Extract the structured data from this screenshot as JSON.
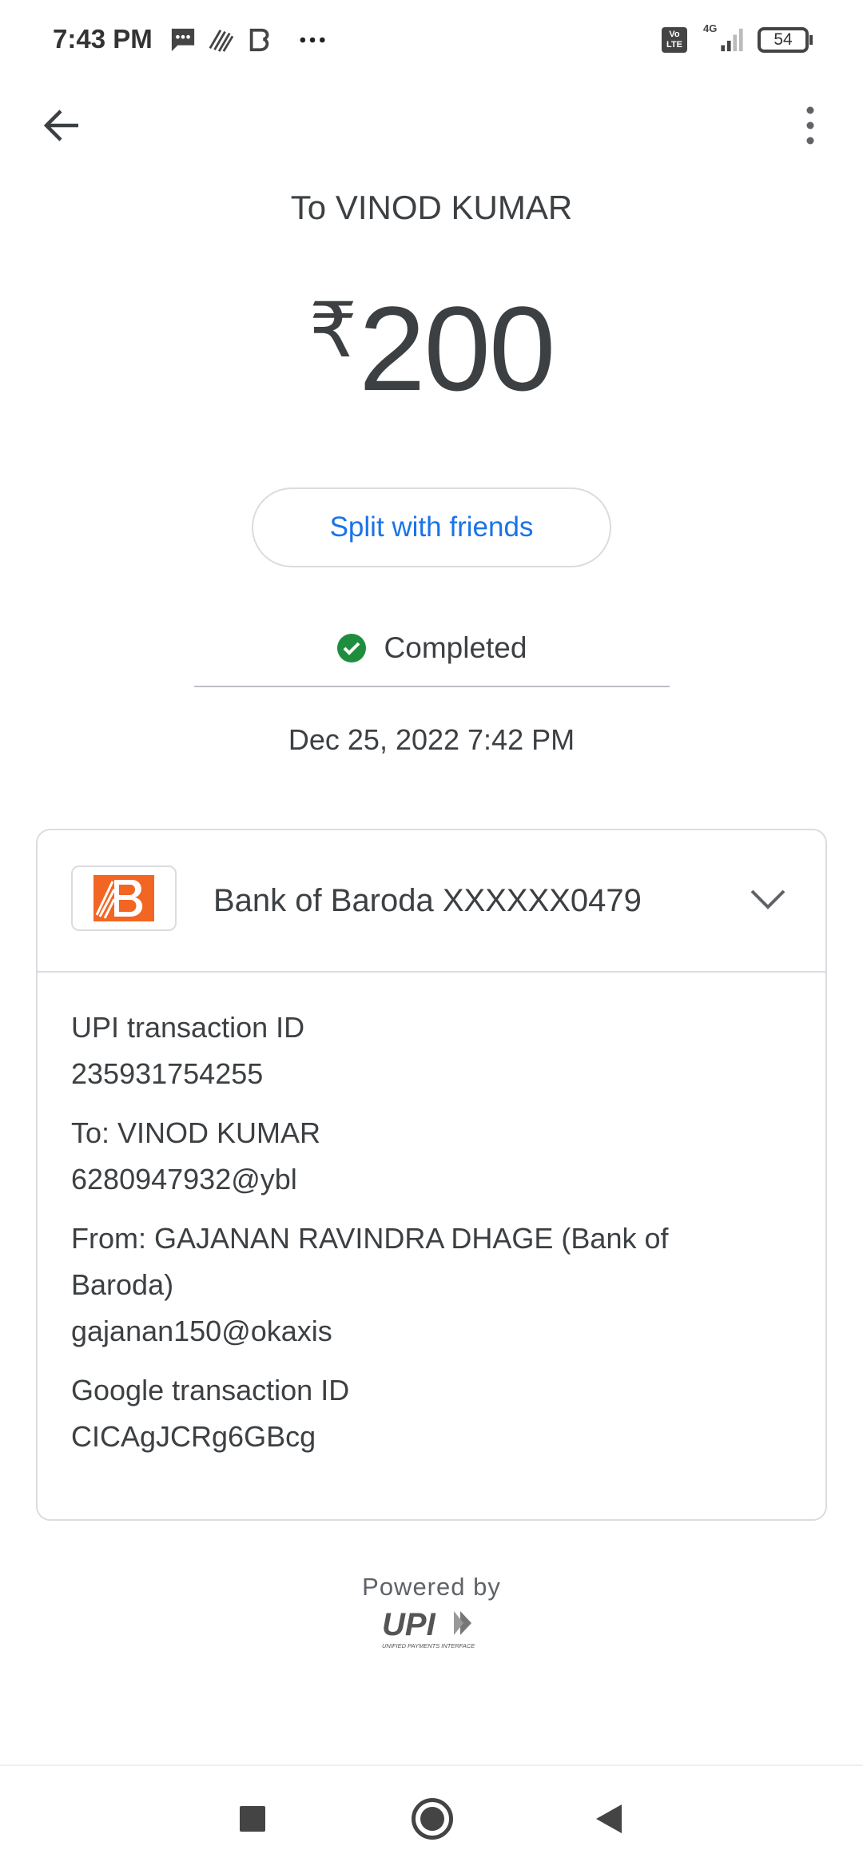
{
  "status_bar": {
    "time": "7:43 PM",
    "battery": "54",
    "network": "4G",
    "volte": "Vo LTE"
  },
  "header": {
    "title": "To VINOD KUMAR"
  },
  "amount": {
    "currency": "₹",
    "value": "200"
  },
  "split_button": "Split with friends",
  "status": {
    "label": "Completed",
    "color": "#1e8e3e"
  },
  "date": "Dec 25, 2022 7:42 PM",
  "card": {
    "bank": "Bank of Baroda XXXXXX0479",
    "details": [
      {
        "label": "UPI transaction ID",
        "value": "235931754255"
      },
      {
        "label": "To: VINOD KUMAR",
        "value": "6280947932@ybl"
      },
      {
        "label": "From: GAJANAN RAVINDRA DHAGE (Bank of Baroda)",
        "value": "gajanan150@okaxis"
      },
      {
        "label": "Google transaction ID",
        "value": "CICAgJCRg6GBcg"
      }
    ]
  },
  "footer": {
    "powered_by": "Powered by",
    "upi_logo": "UPI",
    "upi_tagline": "UNIFIED PAYMENTS INTERFACE"
  },
  "colors": {
    "accent": "#1a73e8",
    "bob_orange": "#f26522"
  }
}
